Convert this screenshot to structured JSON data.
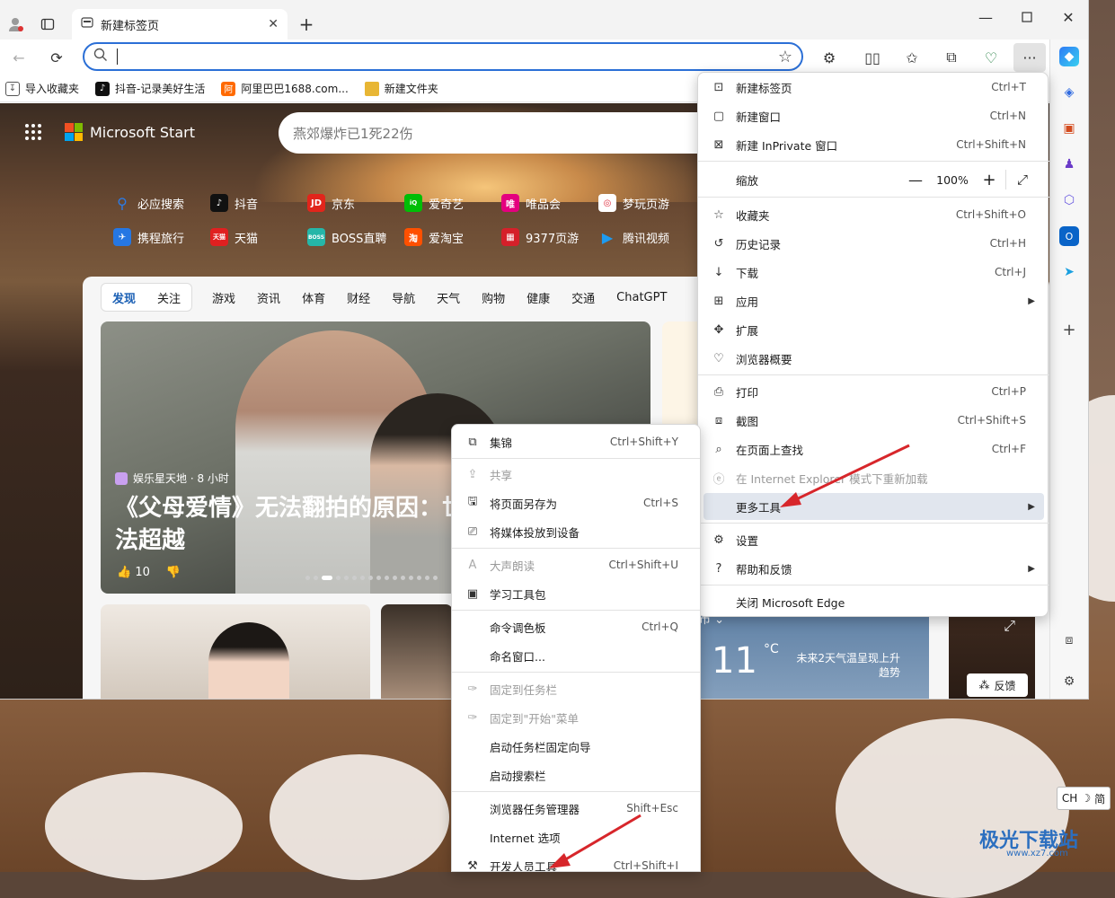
{
  "window": {
    "tab_title": "新建标签页",
    "address_value": "",
    "window_controls": [
      "minimize-icon",
      "maximize-icon",
      "close-icon"
    ]
  },
  "favorites_bar": [
    {
      "label": "导入收藏夹",
      "icon": "import-icon",
      "color": "#555555"
    },
    {
      "label": "抖音-记录美好生活",
      "icon": "douyin-icon",
      "color": "#111111"
    },
    {
      "label": "阿里巴巴1688.com...",
      "icon": "1688-icon",
      "color": "#ff6a00"
    },
    {
      "label": "新建文件夹",
      "icon": "folder-icon",
      "color": "#e8b634"
    }
  ],
  "start_page": {
    "brand": "Microsoft Start",
    "search_placeholder": "燕郊爆炸已1死22伤",
    "quick_links": [
      {
        "label": "必应搜索",
        "icon": "bing-search-icon",
        "color": "#2c7be5"
      },
      {
        "label": "抖音",
        "icon": "douyin-icon",
        "color": "#111111"
      },
      {
        "label": "京东",
        "icon": "jd-icon",
        "color": "#e1251b"
      },
      {
        "label": "爱奇艺",
        "icon": "iqiyi-icon",
        "color": "#00be06"
      },
      {
        "label": "唯品会",
        "icon": "vip-icon",
        "color": "#e4007f"
      },
      {
        "label": "梦玩页游",
        "icon": "game-icon",
        "color": "#e02a3a"
      },
      {
        "label": "携程旅行",
        "icon": "ctrip-icon",
        "color": "#2577e3"
      },
      {
        "label": "天猫",
        "icon": "tmall-icon",
        "color": "#e02020"
      },
      {
        "label": "BOSS直聘",
        "icon": "boss-icon",
        "color": "#25b6a8"
      },
      {
        "label": "爱淘宝",
        "icon": "taobao-icon",
        "color": "#ff5000"
      },
      {
        "label": "9377页游",
        "icon": "9377-icon",
        "color": "#d5202a"
      },
      {
        "label": "腾讯视频",
        "icon": "tencent-video-icon",
        "color": "#1e9bf0"
      }
    ],
    "feed_tabs": [
      "发现",
      "关注",
      "游戏",
      "资讯",
      "体育",
      "财经",
      "导航",
      "天气",
      "购物",
      "健康",
      "交通",
      "ChatGPT"
    ],
    "hero": {
      "source": "娱乐星天地 · 8 小时",
      "title": "《父母爱情》无法翻拍的原因：世，四个角色无法超越",
      "likes": "10"
    },
    "weather": {
      "city": "市",
      "temp": "11",
      "unit": "°C",
      "note": "未来2天气温呈现上升趋势"
    },
    "feedback_label": "反馈"
  },
  "main_menu": {
    "items": [
      {
        "label": "新建标签页",
        "shortcut": "Ctrl+T",
        "icon": "new-tab-icon"
      },
      {
        "label": "新建窗口",
        "shortcut": "Ctrl+N",
        "icon": "new-window-icon"
      },
      {
        "label": "新建 InPrivate 窗口",
        "shortcut": "Ctrl+Shift+N",
        "icon": "inprivate-icon"
      },
      {
        "label": "缩放",
        "zoom": "100%"
      },
      {
        "label": "收藏夹",
        "shortcut": "Ctrl+Shift+O",
        "icon": "favorites-icon"
      },
      {
        "label": "历史记录",
        "shortcut": "Ctrl+H",
        "icon": "history-icon"
      },
      {
        "label": "下载",
        "shortcut": "Ctrl+J",
        "icon": "download-icon"
      },
      {
        "label": "应用",
        "shortcut": "",
        "icon": "apps-icon",
        "submenu": true
      },
      {
        "label": "扩展",
        "shortcut": "",
        "icon": "extensions-icon"
      },
      {
        "label": "浏览器概要",
        "shortcut": "",
        "icon": "browser-essentials-icon"
      },
      {
        "label": "打印",
        "shortcut": "Ctrl+P",
        "icon": "print-icon"
      },
      {
        "label": "截图",
        "shortcut": "Ctrl+Shift+S",
        "icon": "screenshot-icon"
      },
      {
        "label": "在页面上查找",
        "shortcut": "Ctrl+F",
        "icon": "find-icon"
      },
      {
        "label": "在 Internet Explorer 模式下重新加载",
        "shortcut": "",
        "icon": "ie-mode-icon",
        "disabled": true
      },
      {
        "label": "更多工具",
        "shortcut": "",
        "icon": "",
        "submenu": true,
        "highlighted": true
      },
      {
        "label": "设置",
        "shortcut": "",
        "icon": "settings-icon"
      },
      {
        "label": "帮助和反馈",
        "shortcut": "",
        "icon": "help-icon",
        "submenu": true
      },
      {
        "label": "关闭 Microsoft Edge",
        "shortcut": "",
        "icon": ""
      }
    ]
  },
  "more_tools_menu": {
    "items": [
      {
        "label": "集锦",
        "shortcut": "Ctrl+Shift+Y",
        "icon": "collections-icon"
      },
      {
        "label": "共享",
        "shortcut": "",
        "icon": "share-icon",
        "disabled": true
      },
      {
        "label": "将页面另存为",
        "shortcut": "Ctrl+S",
        "icon": "save-page-icon"
      },
      {
        "label": "将媒体投放到设备",
        "shortcut": "",
        "icon": "cast-icon"
      },
      {
        "label": "大声朗读",
        "shortcut": "Ctrl+Shift+U",
        "icon": "read-aloud-icon",
        "disabled": true
      },
      {
        "label": "学习工具包",
        "shortcut": "",
        "icon": "learning-toolkit-icon"
      },
      {
        "label": "命令调色板",
        "shortcut": "Ctrl+Q",
        "icon": ""
      },
      {
        "label": "命名窗口...",
        "shortcut": "",
        "icon": ""
      },
      {
        "label": "固定到任务栏",
        "shortcut": "",
        "icon": "pin-icon",
        "disabled": true
      },
      {
        "label": "固定到\"开始\"菜单",
        "shortcut": "",
        "icon": "pin-start-icon",
        "disabled": true
      },
      {
        "label": "启动任务栏固定向导",
        "shortcut": "",
        "icon": ""
      },
      {
        "label": "启动搜索栏",
        "shortcut": "",
        "icon": ""
      },
      {
        "label": "浏览器任务管理器",
        "shortcut": "Shift+Esc",
        "icon": ""
      },
      {
        "label": "Internet 选项",
        "shortcut": "",
        "icon": ""
      },
      {
        "label": "开发人员工具",
        "shortcut": "Ctrl+Shift+I",
        "icon": "devtools-icon"
      }
    ]
  },
  "taskbar": {
    "language": "CH",
    "ime_mode": "简"
  },
  "watermark": {
    "text": "极光下载站",
    "sub": "www.xz7.com"
  },
  "colors": {
    "accent": "#2b6fd6",
    "arrow": "#d7262b",
    "menu_highlight": "#e1e6ee"
  }
}
